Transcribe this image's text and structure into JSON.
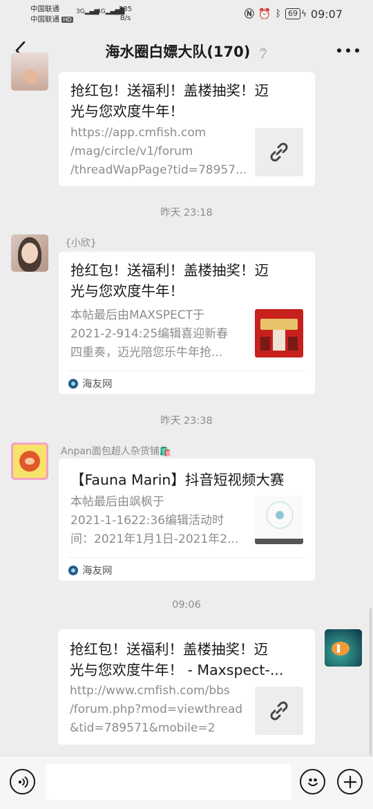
{
  "statusbar": {
    "carrier1": "中国联通",
    "carrier2": "中国联通",
    "hd": "HD",
    "net1": "3G",
    "net2": "4G",
    "speed_value": "235",
    "speed_unit": "B/s",
    "battery": "69",
    "time": "09:07"
  },
  "header": {
    "title": "海水圈白嫖大队(170)"
  },
  "messages": [
    {
      "title_lines": [
        "抢红包！送福利！盖楼抽奖！迈",
        "光与您欢度牛年！"
      ],
      "desc_lines": [
        "https://app.cmfish.com",
        "/mag/circle/v1/forum",
        "/threadWapPage?tid=78957..."
      ]
    },
    {
      "time": "昨天 23:18",
      "sender": "{小欣}",
      "title_lines": [
        "抢红包！送福利！盖楼抽奖！迈",
        "光与您欢度牛年！"
      ],
      "desc_lines": [
        "本帖最后由MAXSPECT于",
        "2021-2-914:25编辑喜迎新春",
        "四重奏，迈光陪您乐牛年抢..."
      ],
      "source": "海友网"
    },
    {
      "time": "昨天 23:38",
      "sender": "Anpan面包超人杂货铺🛍️",
      "title_lines": [
        "【Fauna Marin】抖音短视频大赛"
      ],
      "desc_lines": [
        "本帖最后由飒枫于",
        "2021-1-1622:36编辑活动时",
        "间：2021年1月1日-2021年2..."
      ],
      "source": "海友网"
    },
    {
      "time": "09:06",
      "title_lines": [
        "抢红包！送福利！盖楼抽奖！迈",
        "光与您欢度牛年！ - Maxspect-..."
      ],
      "desc_lines": [
        "http://www.cmfish.com/bbs",
        "/forum.php?mod=viewthread",
        "&tid=789571&mobile=2"
      ]
    }
  ],
  "composer": {
    "placeholder": ""
  },
  "colors": {
    "background": "#ededed",
    "card": "#ffffff",
    "muted_text": "#8c8c8c"
  },
  "icons": [
    "back-arrow-icon",
    "ear-icon",
    "more-icon",
    "link-icon",
    "source-logo-icon",
    "voice-icon",
    "emoji-icon",
    "plus-icon"
  ]
}
